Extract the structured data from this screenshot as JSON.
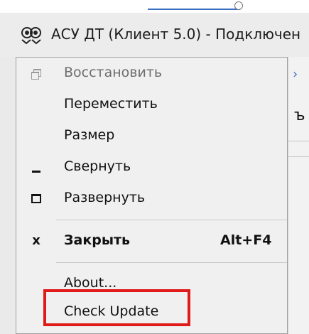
{
  "window": {
    "title": "АСУ ДТ (Клиент 5.0) - Подключен",
    "background_fragment_text": "ъ"
  },
  "system_menu": {
    "items": [
      {
        "label": "Восстановить",
        "icon": "restore-icon",
        "disabled": true
      },
      {
        "label": "Переместить",
        "icon": "",
        "disabled": false
      },
      {
        "label": "Размер",
        "icon": "",
        "disabled": false
      },
      {
        "label": "Свернуть",
        "icon": "minimize-icon",
        "disabled": false
      },
      {
        "label": "Развернуть",
        "icon": "maximize-icon",
        "disabled": false
      },
      {
        "label": "Закрыть",
        "icon": "close-icon",
        "shortcut": "Alt+F4",
        "bold": true,
        "disabled": false
      },
      {
        "label": "About...",
        "icon": "",
        "disabled": false
      },
      {
        "label": "Check Update",
        "icon": "",
        "disabled": false,
        "highlighted": true
      }
    ]
  },
  "colors": {
    "menu_background": "#f0f0f0",
    "highlight_border": "#e01919",
    "titlebar_background": "#ececec"
  }
}
